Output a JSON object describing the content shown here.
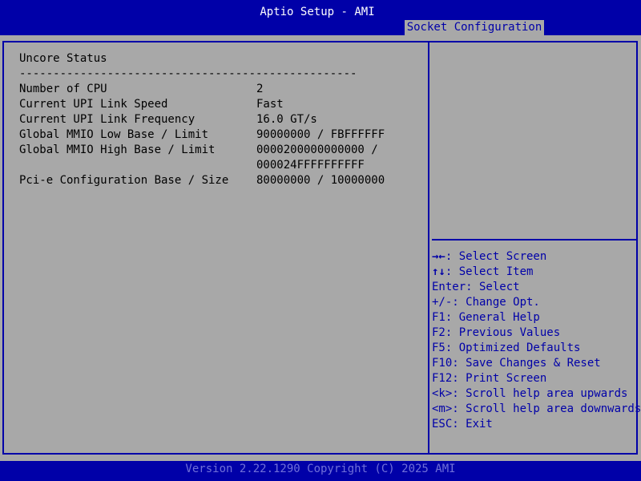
{
  "header": {
    "title": "Aptio Setup - AMI",
    "active_tab": "Socket Configuration"
  },
  "main": {
    "section_title": "Uncore Status",
    "separator": "--------------------------------------------------",
    "rows": [
      {
        "label": "Number of CPU",
        "value": "2"
      },
      {
        "label": "Current UPI Link Speed",
        "value": "Fast"
      },
      {
        "label": "Current UPI Link Frequency",
        "value": "16.0 GT/s"
      },
      {
        "label": "Global MMIO Low Base / Limit",
        "value": "90000000 / FBFFFFFF"
      },
      {
        "label": "Global MMIO High Base / Limit",
        "value": "0000200000000000 /",
        "value_cont": "000024FFFFFFFFFF"
      },
      {
        "label": "Pci-e Configuration Base / Size",
        "value": "80000000 / 10000000"
      }
    ]
  },
  "help": {
    "items": [
      {
        "key": "→←",
        "text": ": Select Screen"
      },
      {
        "key": "↑↓",
        "text": ": Select Item"
      },
      {
        "key": "",
        "text": "Enter: Select"
      },
      {
        "key": "",
        "text": "+/-: Change Opt."
      },
      {
        "key": "",
        "text": "F1: General Help"
      },
      {
        "key": "",
        "text": "F2: Previous Values"
      },
      {
        "key": "",
        "text": "F5: Optimized Defaults"
      },
      {
        "key": "",
        "text": "F10: Save Changes & Reset"
      },
      {
        "key": "",
        "text": "F12: Print Screen"
      },
      {
        "key": "",
        "text": "<k>: Scroll help area upwards"
      },
      {
        "key": "",
        "text": "<m>: Scroll help area downwards"
      },
      {
        "key": "",
        "text": "ESC: Exit"
      }
    ]
  },
  "footer": {
    "version": "Version 2.22.1290 Copyright (C) 2025 AMI"
  },
  "colors": {
    "bios_blue": "#0000a8",
    "panel_gray": "#a8a8a8",
    "footer_text": "#7070d8"
  }
}
